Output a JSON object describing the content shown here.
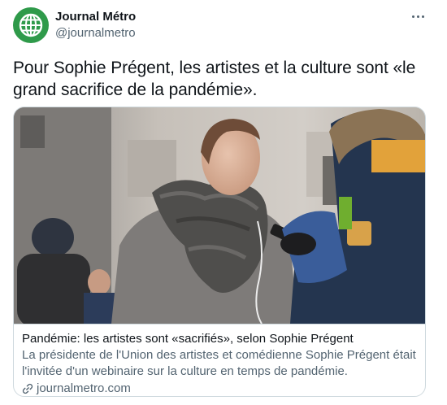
{
  "author": {
    "name": "Journal Métro",
    "handle": "@journalmetro",
    "avatar_icon": "globe-icon",
    "avatar_color": "#2f9a4a"
  },
  "more_icon": "more-options-icon",
  "tweet": {
    "text": "Pour Sophie Prégent, les artistes et la culture sont «le grand sacrifice de la pandémie»."
  },
  "card": {
    "title": "Pandémie: les artistes sont «sacrifiés», selon Sophie Prégent",
    "description": "La présidente de l'Union des artistes et comédienne Sophie Prégent était l'invitée d'un webinaire sur la culture en temps de pandémie.",
    "domain": "journalmetro.com",
    "link_icon": "link-icon"
  },
  "colors": {
    "text_primary": "#0f1419",
    "text_secondary": "#536471",
    "border": "#cfd9de"
  }
}
